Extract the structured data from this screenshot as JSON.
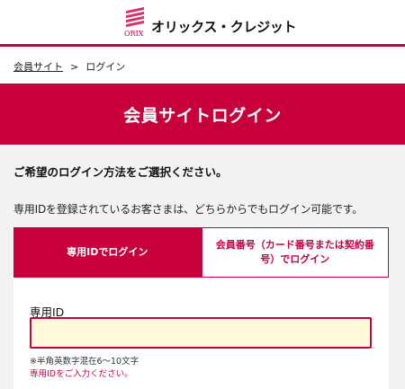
{
  "header": {
    "logo_text": "ORIX",
    "brand_name": "オリックス・クレジット",
    "accent_color": "#c8003c"
  },
  "breadcrumb": {
    "home_link": "会員サイト",
    "separator": ">",
    "current": "ログイン"
  },
  "banner": {
    "title": "会員サイトログイン"
  },
  "instructions": {
    "title": "ご希望のログイン方法をご選択ください。",
    "text": "専用IDを登録されているお客さまは、どちらからでもログイン可能です。"
  },
  "tabs": [
    {
      "label": "専用IDでログイン",
      "active": true
    },
    {
      "label": "会員番号（カード番号または契約番号）でログイン",
      "active": false
    }
  ],
  "form": {
    "id_label": "専用ID",
    "id_value": "",
    "hint": "※半角英数字混在6～10文字",
    "error": "専用IDをご入力ください。"
  }
}
